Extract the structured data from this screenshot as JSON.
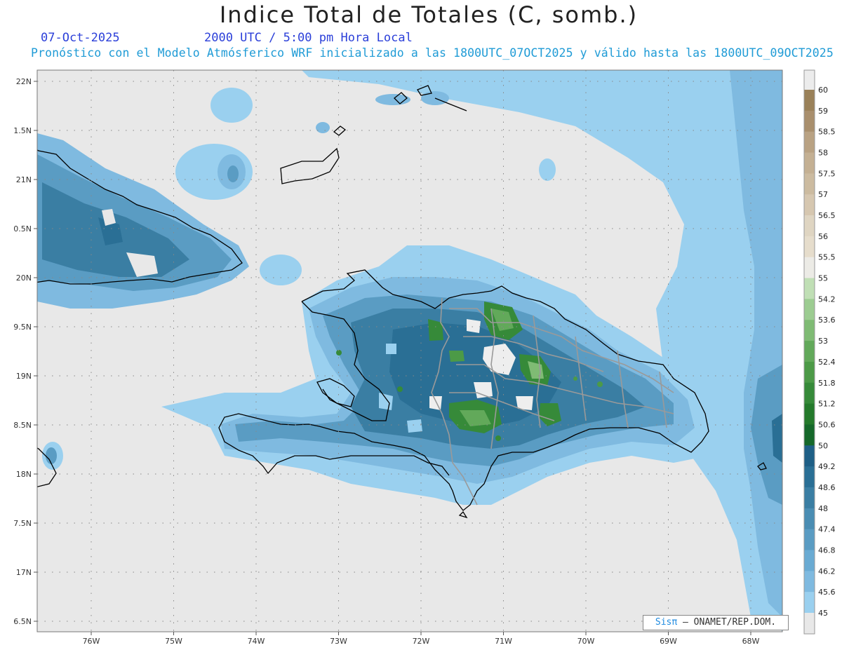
{
  "title": "Indice Total de Totales (C, somb.)",
  "date": "07-Oct-2025",
  "time": "2000 UTC / 5:00 pm Hora Local",
  "forecast": "Pronóstico con el Modelo Atmósferico WRF inicializado a las 1800UTC_07OCT2025 y válido hasta las  1800UTC_09OCT2025",
  "credit": {
    "sis": "Sisπ",
    "rest": "– ONAMET/REP.DOM."
  },
  "lat_labels": [
    "22N",
    "1.5N",
    "21N",
    "0.5N",
    "20N",
    "9.5N",
    "19N",
    "8.5N",
    "18N",
    "7.5N",
    "17N",
    "6.5N"
  ],
  "lat_values": [
    22,
    21.5,
    21,
    20.5,
    20,
    19.5,
    19,
    18.5,
    18,
    17.5,
    17,
    16.5
  ],
  "lon_labels": [
    "76W",
    "75W",
    "74W",
    "73W",
    "72W",
    "71W",
    "70W",
    "69W",
    "68W"
  ],
  "lon_values": [
    -76,
    -75,
    -74,
    -73,
    -72,
    -71,
    -70,
    -69,
    -68
  ],
  "colorbar": {
    "labels": [
      "60",
      "59",
      "58.5",
      "58",
      "57.5",
      "57",
      "56.5",
      "56",
      "55.5",
      "55",
      "54.2",
      "53.6",
      "53",
      "52.4",
      "51.8",
      "51.2",
      "50.6",
      "50",
      "49.2",
      "48.6",
      "48",
      "47.4",
      "46.8",
      "46.2",
      "45.6",
      "45"
    ],
    "colors": [
      "#9a8159",
      "#a98f6d",
      "#b9a283",
      "#c4b093",
      "#ccbba0",
      "#d6c7b0",
      "#dfd5c2",
      "#e6ddcc",
      "#ecebe6",
      "#c0dfb5",
      "#9ccc91",
      "#7fbb74",
      "#62a95a",
      "#4c9a47",
      "#368a39",
      "#247a2b",
      "#15682a",
      "#1e5f86",
      "#2a6f95",
      "#3a7ea3",
      "#4a8db3",
      "#5a9cc3",
      "#6aabd3",
      "#7fbae0",
      "#9ad0ef"
    ],
    "bottom_color": "#e8e8e8"
  },
  "colors": {
    "background": "#e8e8e8",
    "light_blue": "#9ad0ef",
    "mid_blue": "#5a9cc3",
    "dark_blue": "#2a6f95",
    "green": "#368a39",
    "light_green": "#7fbb74"
  }
}
